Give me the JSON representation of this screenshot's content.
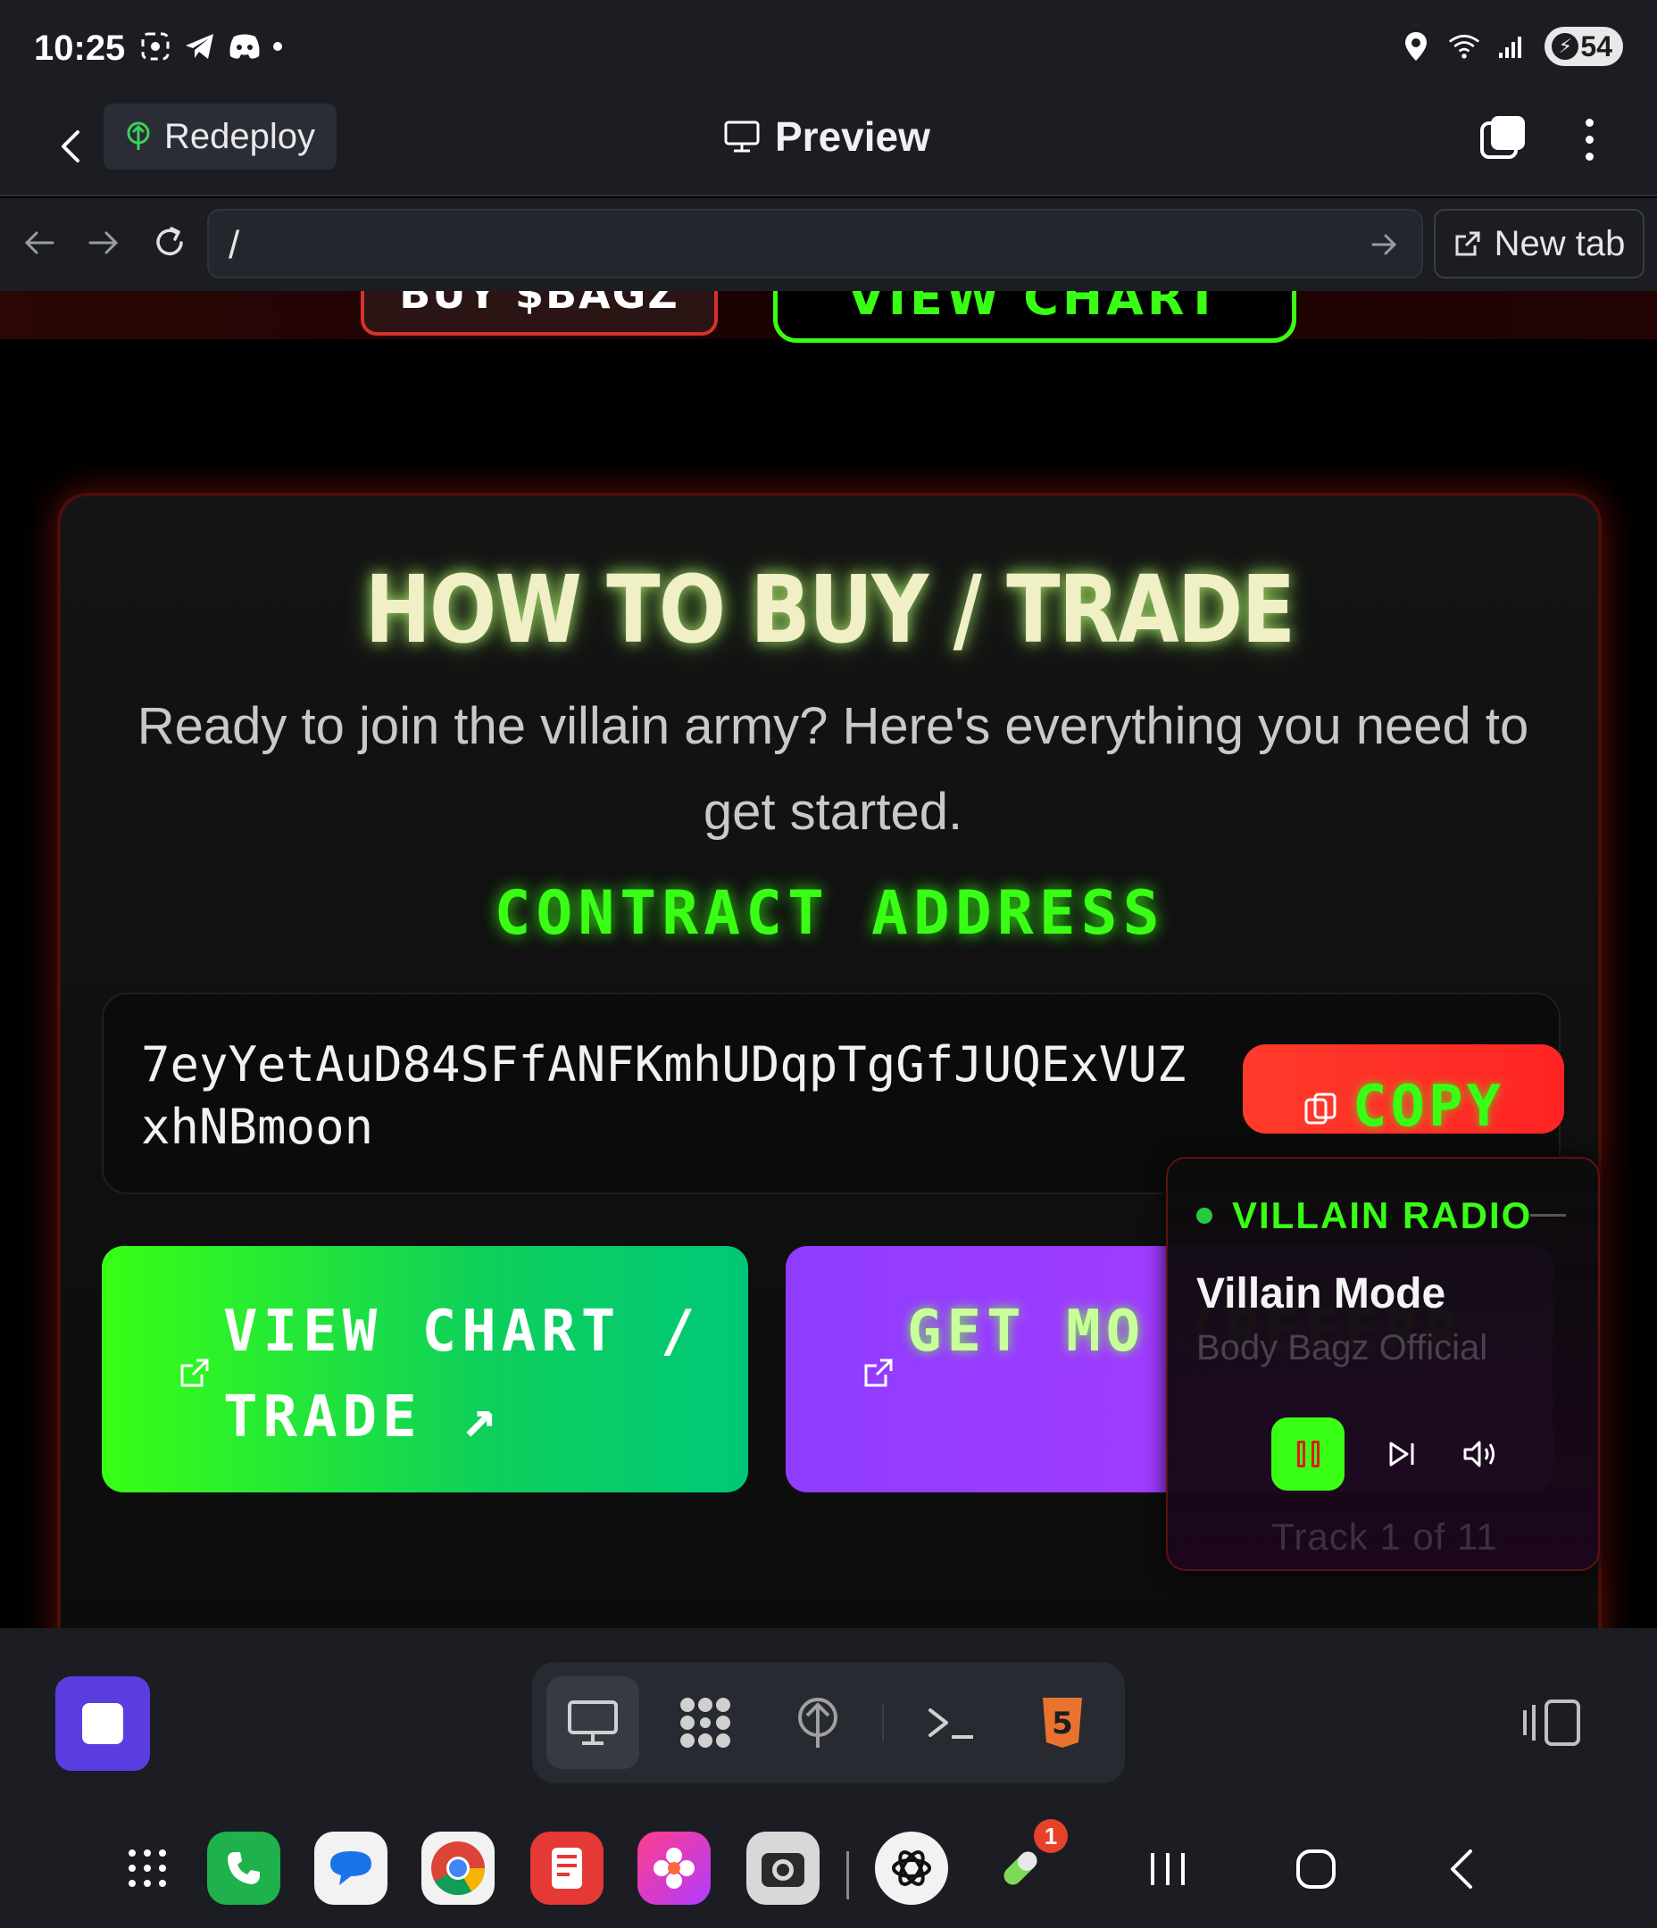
{
  "status_bar": {
    "time": "10:25",
    "battery": "54",
    "icons": [
      "screenshot-icon",
      "telegram-icon",
      "discord-icon",
      "location-icon",
      "wifi-icon",
      "signal-icon",
      "battery-icon"
    ]
  },
  "app_bar": {
    "redeploy_label": "Redeploy",
    "preview_label": "Preview"
  },
  "url_bar": {
    "url": "/",
    "new_tab_label": "New tab"
  },
  "page": {
    "top_buttons": {
      "buy": "BUY $BAGZ",
      "chart": "VIEW CHART"
    },
    "section_title": "HOW TO BUY / TRADE",
    "section_subtitle": "Ready to join the villain army? Here's everything you need to get started.",
    "contract_label": "CONTRACT ADDRESS",
    "contract_address": "7eyYetAuD84SFfANFKmhUDqpTgGfJUQExVUZxhNBmoon",
    "copy_label": "COPY",
    "cta_chart": "VIEW CHART / TRADE ↗",
    "cta_refer": "GET MO (REFERR"
  },
  "radio": {
    "name": "VILLAIN RADIO",
    "song": "Villain Mode",
    "artist": "Body Bagz Official",
    "track": "Track 1 of 11"
  },
  "colors": {
    "neon_green": "#39ff14",
    "villain_red": "#ff2424",
    "purple": "#9b3cff",
    "chrome_bg": "#1b1d23"
  },
  "dock": {
    "notification_count": "1",
    "apps": [
      "app-drawer-icon",
      "phone-icon",
      "messages-icon",
      "chrome-icon",
      "notes-icon",
      "gallery-icon",
      "camera-icon",
      "chatgpt-icon",
      "pill-app-icon"
    ]
  }
}
